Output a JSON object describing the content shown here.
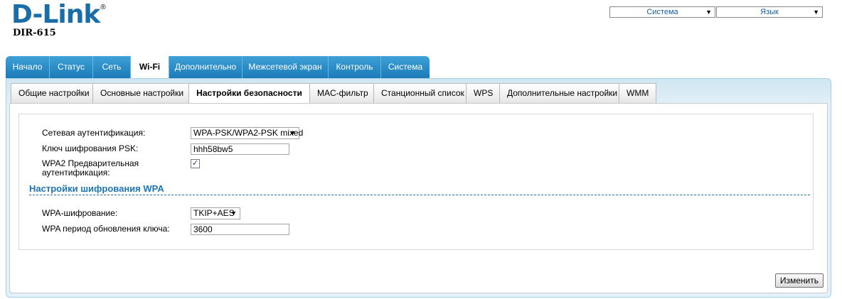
{
  "logo": {
    "text": "D-Link",
    "reg": "®"
  },
  "model": "DIR-615",
  "top_selects": {
    "system": {
      "value": "Система"
    },
    "language": {
      "value": "Язык"
    }
  },
  "nav": {
    "items": [
      "Начало",
      "Статус",
      "Сеть",
      "Wi-Fi",
      "Дополнительно",
      "Межсетевой экран",
      "Контроль",
      "Система"
    ],
    "active": "Wi-Fi"
  },
  "subtabs": {
    "items": [
      "Общие настройки",
      "Основные настройки",
      "Настройки безопасности",
      "MAC-фильтр",
      "Станционный список",
      "WPS",
      "Дополнительные настройки",
      "WMM"
    ],
    "active": "Настройки безопасности"
  },
  "form": {
    "auth_label": "Сетевая аутентификация:",
    "auth_value": "WPA-PSK/WPA2-PSK mixed",
    "psk_label": "Ключ шифрования PSK:",
    "psk_value": "hhh58bw5",
    "preauth_label_line1": "WPA2 Предварительная",
    "preauth_label_line2": "аутентификация:",
    "preauth_checked": true,
    "section_title": "Настройки шифрования WPA",
    "wpa_enc_label": "WPA-шифрование:",
    "wpa_enc_value": "TKIP+AES",
    "rekey_label": "WPA период обновления ключа:",
    "rekey_value": "3600"
  },
  "buttons": {
    "change": "Изменить"
  },
  "icons": {
    "dropdown": "triangle-down-icon",
    "checkbox_mark": "✓"
  }
}
